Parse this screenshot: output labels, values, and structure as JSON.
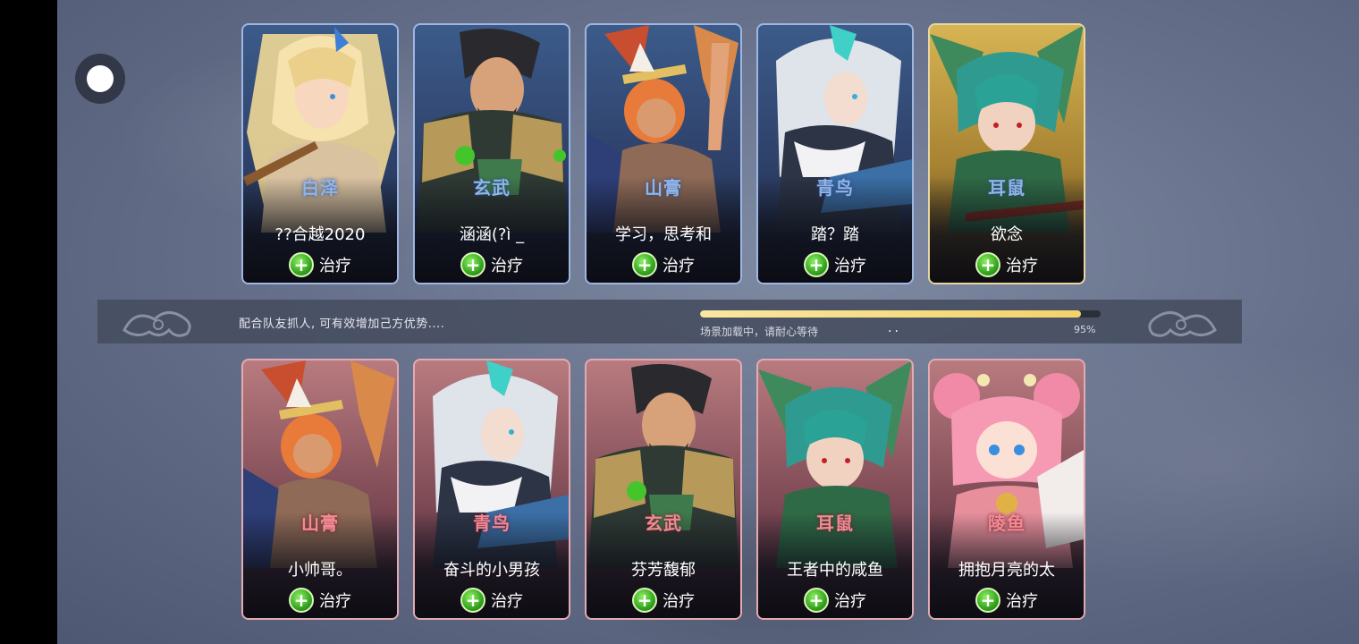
{
  "loading": {
    "tip": "配合队友抓人, 可有效增加己方优势....",
    "status": "场景加载中，请耐心等待",
    "dots": "..",
    "percent_label": "95%",
    "progress": 0.95
  },
  "team_blue": [
    {
      "hero": "白泽",
      "player": "??合越2020",
      "skill": "治疗"
    },
    {
      "hero": "玄武",
      "player": "涵涵(?ì _",
      "skill": "治疗"
    },
    {
      "hero": "山膏",
      "player": "学习，思考和",
      "skill": "治疗"
    },
    {
      "hero": "青鸟",
      "player": "踏？踏",
      "skill": "治疗"
    },
    {
      "hero": "耳鼠",
      "player": "欲念",
      "skill": "治疗"
    }
  ],
  "team_red": [
    {
      "hero": "山膏",
      "player": "小帅哥。",
      "skill": "治疗"
    },
    {
      "hero": "青鸟",
      "player": "奋斗的小男孩",
      "skill": "治疗"
    },
    {
      "hero": "玄武",
      "player": "芬芳馥郁",
      "skill": "治疗"
    },
    {
      "hero": "耳鼠",
      "player": "王者中的咸鱼",
      "skill": "治疗"
    },
    {
      "hero": "陵鱼",
      "player": "拥抱月亮的太",
      "skill": "治疗"
    }
  ],
  "icons": {
    "float_button": "assistive-touch-icon",
    "skill": "heal-cross-icon",
    "decoration": "cloud-swirl-icon"
  },
  "colors": {
    "blue_frame": "#9eb7e0",
    "gold_frame": "#e8d6a0",
    "red_frame": "#e2aab2",
    "progress": "#f3d36a",
    "heal": "#35a51e"
  }
}
